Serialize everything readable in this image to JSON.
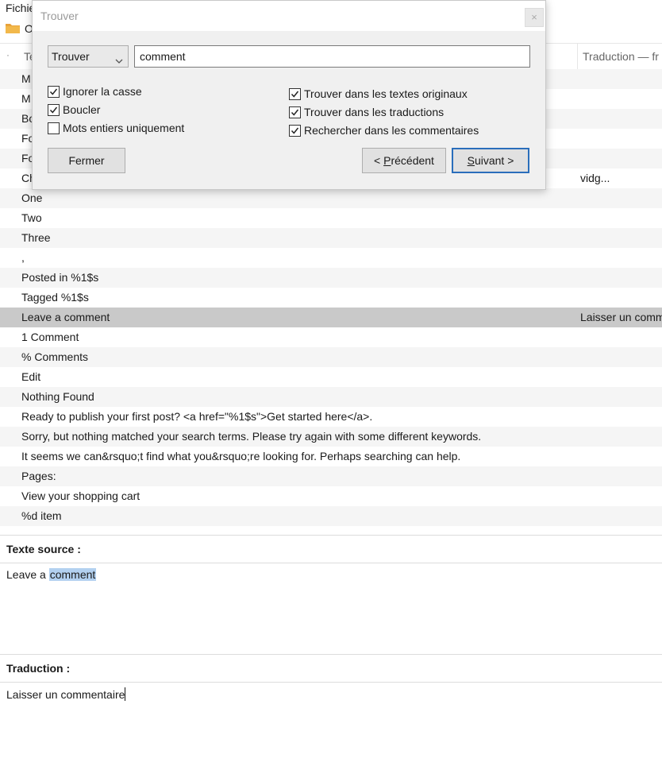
{
  "menubar": {
    "file_label": "Fichier",
    "toolbar_label": "O"
  },
  "header": {
    "dot": "·",
    "source_col": "Te",
    "translation_col": "Traduction — fr"
  },
  "rows": [
    {
      "source": "M",
      "translation": ""
    },
    {
      "source": "M",
      "translation": ""
    },
    {
      "source": "Bo",
      "translation": ""
    },
    {
      "source": "Fo",
      "translation": ""
    },
    {
      "source": "Fo",
      "translation": ""
    },
    {
      "source": "Ch",
      "translation": "vidg..."
    },
    {
      "source": "One",
      "translation": ""
    },
    {
      "source": "Two",
      "translation": ""
    },
    {
      "source": "Three",
      "translation": ""
    },
    {
      "source": ",",
      "translation": ""
    },
    {
      "source": "Posted in %1$s",
      "translation": ""
    },
    {
      "source": "Tagged %1$s",
      "translation": ""
    },
    {
      "source": "Leave a comment",
      "translation": "Laisser un comm"
    },
    {
      "source": "1 Comment",
      "translation": ""
    },
    {
      "source": "% Comments",
      "translation": ""
    },
    {
      "source": "Edit",
      "translation": ""
    },
    {
      "source": "Nothing Found",
      "translation": ""
    },
    {
      "source": "Ready to publish your first post? <a href=\"%1$s\">Get started here</a>.",
      "translation": ""
    },
    {
      "source": "Sorry, but nothing matched your search terms. Please try again with some different keywords.",
      "translation": ""
    },
    {
      "source": "It seems we can&rsquo;t find what you&rsquo;re looking for. Perhaps searching can help.",
      "translation": ""
    },
    {
      "source": "Pages:",
      "translation": ""
    },
    {
      "source": "View your shopping cart",
      "translation": ""
    },
    {
      "source": "%d item",
      "translation": ""
    }
  ],
  "selected_row_index": 12,
  "source_pane": {
    "label": "Texte source :",
    "text_before": "Leave a ",
    "text_highlight": "comment"
  },
  "translation_pane": {
    "label": "Traduction :",
    "text": "Laisser un commentaire"
  },
  "dialog": {
    "title": "Trouver",
    "close_glyph": "×",
    "mode": "Trouver",
    "query": "comment",
    "options_left": [
      {
        "label": "Ignorer la casse",
        "checked": true
      },
      {
        "label": "Boucler",
        "checked": true
      },
      {
        "label": "Mots entiers uniquement",
        "checked": false
      }
    ],
    "options_right": [
      {
        "label": "Trouver dans les textes originaux",
        "checked": true
      },
      {
        "label": "Trouver dans les traductions",
        "checked": true
      },
      {
        "label": "Rechercher dans les commentaires",
        "checked": true
      }
    ],
    "close_button": "Fermer",
    "prev_button": {
      "prefix": "< ",
      "accel": "P",
      "rest": "récédent"
    },
    "next_button": {
      "accel": "S",
      "rest": "uivant >"
    }
  },
  "colors": {
    "accent": "#2a6ebb",
    "selection": "#c9c9c9",
    "highlight": "#b3d1f0",
    "folder": "#e8a33a"
  }
}
